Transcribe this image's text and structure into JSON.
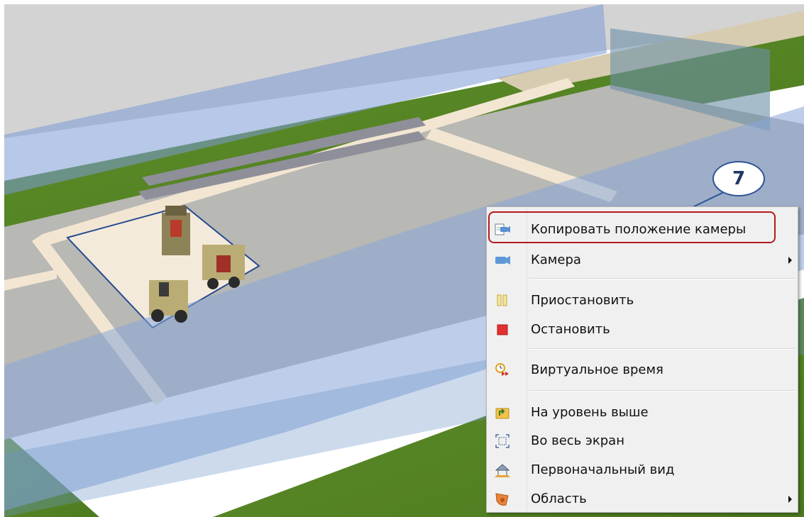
{
  "callout": {
    "number": "7"
  },
  "context_menu": {
    "items": [
      {
        "label": "Копировать положение камеры",
        "icon": "copy-camera-icon",
        "submenu": false,
        "highlighted": true
      },
      {
        "label": "Камера",
        "icon": "camera-icon",
        "submenu": true
      },
      {
        "label": "Приостановить",
        "icon": "pause-icon",
        "submenu": false
      },
      {
        "label": "Остановить",
        "icon": "stop-icon",
        "submenu": false
      },
      {
        "label": "Виртуальное время",
        "icon": "virtual-time-icon",
        "submenu": false
      },
      {
        "label": "На уровень выше",
        "icon": "level-up-icon",
        "submenu": false
      },
      {
        "label": "Во весь экран",
        "icon": "fullscreen-icon",
        "submenu": false
      },
      {
        "label": "Первоначальный вид",
        "icon": "home-view-icon",
        "submenu": false
      },
      {
        "label": "Область",
        "icon": "area-icon",
        "submenu": true
      }
    ]
  },
  "colors": {
    "highlight": "#b31b1b",
    "callout_border": "#2f5597",
    "callout_text": "#1f3864"
  }
}
